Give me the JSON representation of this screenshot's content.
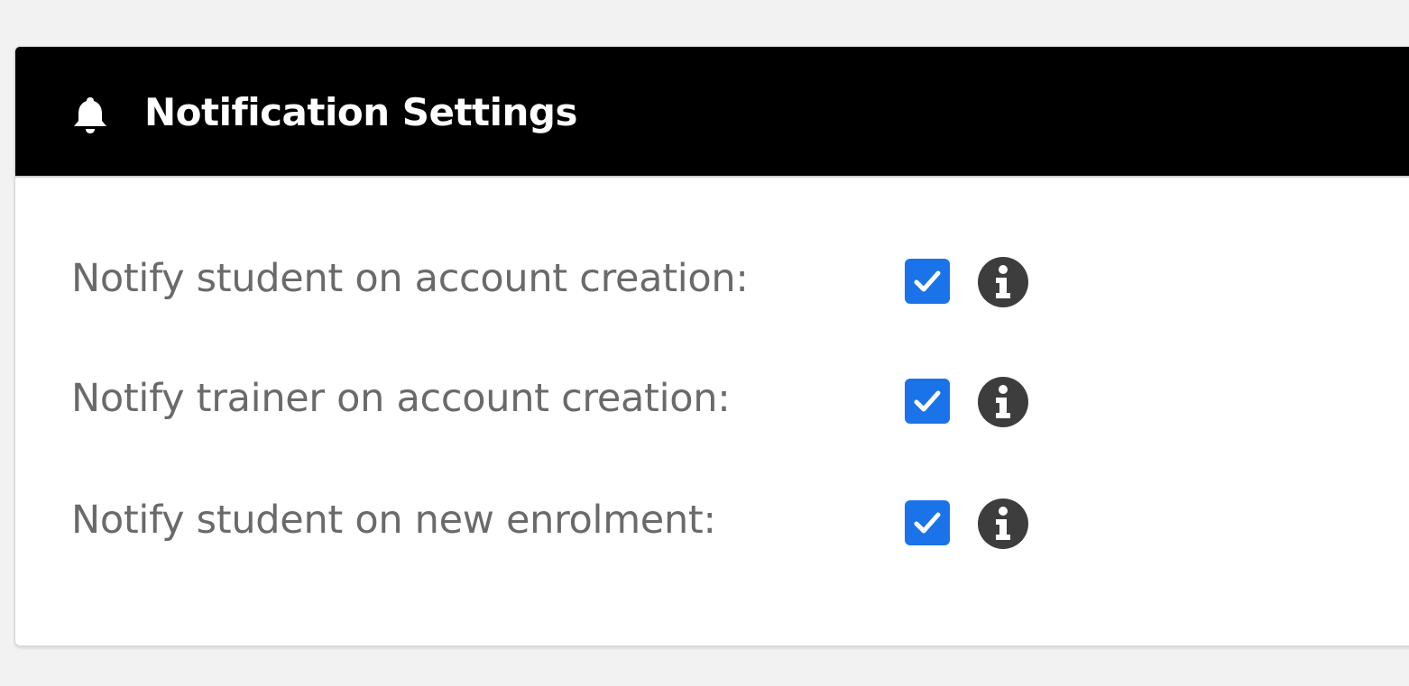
{
  "panel": {
    "title": "Notification Settings",
    "icon": "bell-icon"
  },
  "settings": [
    {
      "label": "Notify student on account creation:",
      "checked": true,
      "info_icon": "info-icon"
    },
    {
      "label": "Notify trainer on account creation:",
      "checked": true,
      "info_icon": "info-icon"
    },
    {
      "label": "Notify student on new enrolment:",
      "checked": true,
      "info_icon": "info-icon"
    }
  ],
  "colors": {
    "header_bg": "#000000",
    "header_text": "#ffffff",
    "label_text": "#6a6a6a",
    "checkbox_accent": "#1a73e8",
    "info_icon": "#3d3d3d",
    "page_bg": "#f2f2f2"
  }
}
